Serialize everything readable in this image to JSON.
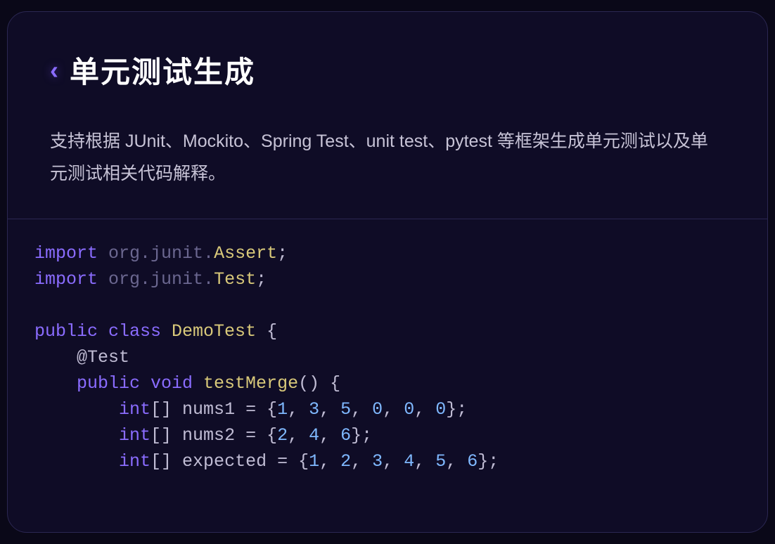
{
  "header": {
    "chevron": "‹",
    "title": "单元测试生成",
    "description": "支持根据 JUnit、Mockito、Spring Test、unit test、pytest 等框架生成单元测试以及单元测试相关代码解释。"
  },
  "code": {
    "lines": [
      [
        {
          "t": "import ",
          "c": "key"
        },
        {
          "t": "org.junit.",
          "c": "pkg"
        },
        {
          "t": "Assert",
          "c": "type"
        },
        {
          "t": ";",
          "c": "plain"
        }
      ],
      [
        {
          "t": "import ",
          "c": "key"
        },
        {
          "t": "org.junit.",
          "c": "pkg"
        },
        {
          "t": "Test",
          "c": "type"
        },
        {
          "t": ";",
          "c": "plain"
        }
      ],
      [],
      [
        {
          "t": "public class ",
          "c": "key"
        },
        {
          "t": "DemoTest",
          "c": "type"
        },
        {
          "t": " {",
          "c": "plain"
        }
      ],
      [
        {
          "t": "    ",
          "c": "plain"
        },
        {
          "t": "@Test",
          "c": "ann"
        }
      ],
      [
        {
          "t": "    ",
          "c": "plain"
        },
        {
          "t": "public void ",
          "c": "key"
        },
        {
          "t": "testMerge",
          "c": "func"
        },
        {
          "t": "() {",
          "c": "plain"
        }
      ],
      [
        {
          "t": "        ",
          "c": "plain"
        },
        {
          "t": "int",
          "c": "key"
        },
        {
          "t": "[] nums1 = {",
          "c": "plain"
        },
        {
          "t": "1",
          "c": "num"
        },
        {
          "t": ", ",
          "c": "plain"
        },
        {
          "t": "3",
          "c": "num"
        },
        {
          "t": ", ",
          "c": "plain"
        },
        {
          "t": "5",
          "c": "num"
        },
        {
          "t": ", ",
          "c": "plain"
        },
        {
          "t": "0",
          "c": "num"
        },
        {
          "t": ", ",
          "c": "plain"
        },
        {
          "t": "0",
          "c": "num"
        },
        {
          "t": ", ",
          "c": "plain"
        },
        {
          "t": "0",
          "c": "num"
        },
        {
          "t": "};",
          "c": "plain"
        }
      ],
      [
        {
          "t": "        ",
          "c": "plain"
        },
        {
          "t": "int",
          "c": "key"
        },
        {
          "t": "[] nums2 = {",
          "c": "plain"
        },
        {
          "t": "2",
          "c": "num"
        },
        {
          "t": ", ",
          "c": "plain"
        },
        {
          "t": "4",
          "c": "num"
        },
        {
          "t": ", ",
          "c": "plain"
        },
        {
          "t": "6",
          "c": "num"
        },
        {
          "t": "};",
          "c": "plain"
        }
      ],
      [
        {
          "t": "        ",
          "c": "plain"
        },
        {
          "t": "int",
          "c": "key"
        },
        {
          "t": "[] expected = {",
          "c": "plain"
        },
        {
          "t": "1",
          "c": "num"
        },
        {
          "t": ", ",
          "c": "plain"
        },
        {
          "t": "2",
          "c": "num"
        },
        {
          "t": ", ",
          "c": "plain"
        },
        {
          "t": "3",
          "c": "num"
        },
        {
          "t": ", ",
          "c": "plain"
        },
        {
          "t": "4",
          "c": "num"
        },
        {
          "t": ", ",
          "c": "plain"
        },
        {
          "t": "5",
          "c": "num"
        },
        {
          "t": ", ",
          "c": "plain"
        },
        {
          "t": "6",
          "c": "num"
        },
        {
          "t": "};",
          "c": "plain"
        }
      ]
    ]
  }
}
